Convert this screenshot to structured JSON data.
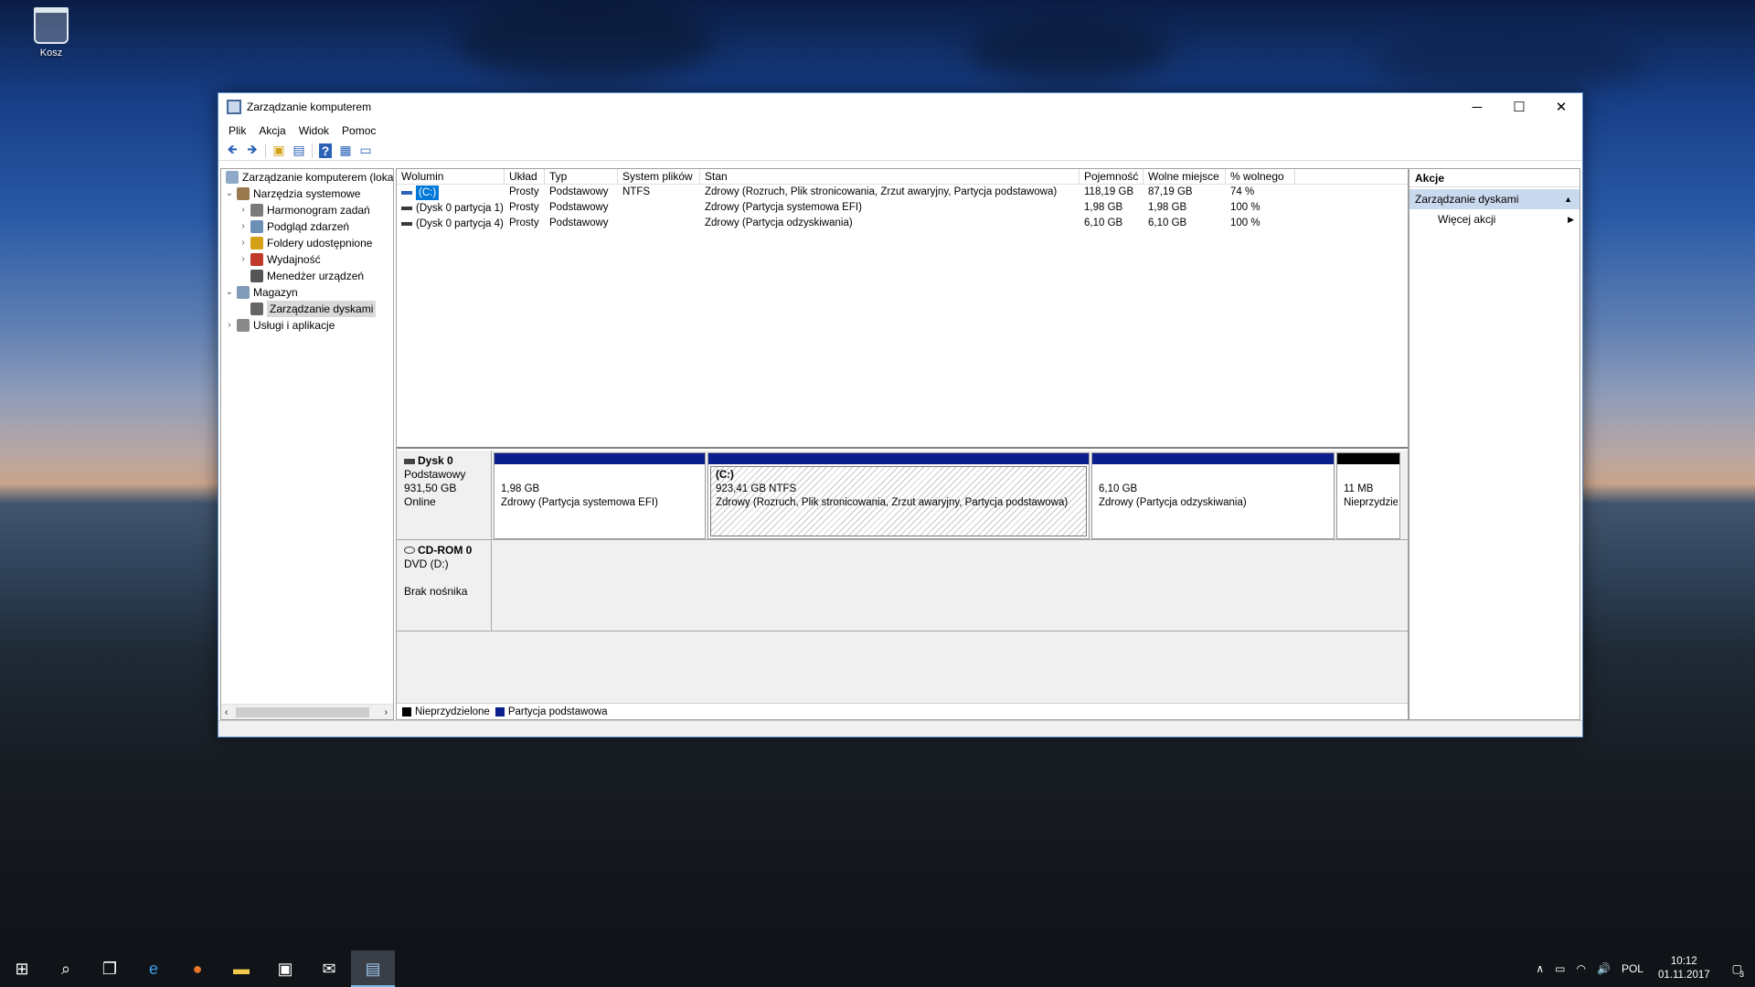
{
  "desktop": {
    "recycle_bin_label": "Kosz"
  },
  "window": {
    "title": "Zarządzanie komputerem",
    "min": "─",
    "max": "☐",
    "close": "✕"
  },
  "menu": [
    "Plik",
    "Akcja",
    "Widok",
    "Pomoc"
  ],
  "toolbar": [
    {
      "icon": "back-arrow-icon",
      "glyph": "🡸"
    },
    {
      "icon": "forward-arrow-icon",
      "glyph": "🡺"
    },
    {
      "icon": "up-folder-icon",
      "glyph": "▣"
    },
    {
      "icon": "show-hide-tree-icon",
      "glyph": "▤"
    },
    {
      "icon": "help-icon",
      "glyph": "?"
    },
    {
      "icon": "properties-icon",
      "glyph": "▦"
    },
    {
      "icon": "export-list-icon",
      "glyph": "▭"
    }
  ],
  "tree": {
    "root": "Zarządzanie komputerem (loka",
    "items": [
      {
        "label": "Narzędzia systemowe",
        "level": 1,
        "tw": "⌄",
        "icon": "tools-icon"
      },
      {
        "label": "Harmonogram zadań",
        "level": 2,
        "tw": "›",
        "icon": "clock-icon"
      },
      {
        "label": "Podgląd zdarzeń",
        "level": 2,
        "tw": "›",
        "icon": "event-viewer-icon"
      },
      {
        "label": "Foldery udostępnione",
        "level": 2,
        "tw": "›",
        "icon": "shared-folder-icon"
      },
      {
        "label": "Wydajność",
        "level": 2,
        "tw": "›",
        "icon": "performance-icon"
      },
      {
        "label": "Menedżer urządzeń",
        "level": 2,
        "tw": "",
        "icon": "device-manager-icon"
      },
      {
        "label": "Magazyn",
        "level": 1,
        "tw": "⌄",
        "icon": "storage-icon"
      },
      {
        "label": "Zarządzanie dyskami",
        "level": 2,
        "tw": "",
        "icon": "disk-icon",
        "selected": true
      },
      {
        "label": "Usługi i aplikacje",
        "level": 1,
        "tw": "›",
        "icon": "services-icon"
      }
    ]
  },
  "grid": {
    "headers": [
      "Wolumin",
      "Układ",
      "Typ",
      "System plików",
      "Stan",
      "Pojemność",
      "Wolne miejsce",
      "% wolnego"
    ],
    "rows": [
      [
        "(C:)",
        "Prosty",
        "Podstawowy",
        "NTFS",
        "Zdrowy (Rozruch, Plik stronicowania, Zrzut awaryjny, Partycja podstawowa)",
        "118,19 GB",
        "87,19 GB",
        "74 %"
      ],
      [
        "(Dysk 0 partycja 1)",
        "Prosty",
        "Podstawowy",
        "",
        "Zdrowy (Partycja systemowa EFI)",
        "1,98 GB",
        "1,98 GB",
        "100 %"
      ],
      [
        "(Dysk 0 partycja 4)",
        "Prosty",
        "Podstawowy",
        "",
        "Zdrowy (Partycja odzyskiwania)",
        "6,10 GB",
        "6,10 GB",
        "100 %"
      ]
    ]
  },
  "disks": [
    {
      "name": "Dysk 0",
      "lines": [
        "Podstawowy",
        "931,50 GB",
        "Online"
      ],
      "partitions": [
        {
          "title": "",
          "size": "1,98 GB",
          "status": "Zdrowy (Partycja systemowa EFI)"
        },
        {
          "title": "(C:)",
          "size": "923,41 GB NTFS",
          "status": "Zdrowy (Rozruch, Plik stronicowania, Zrzut awaryjny, Partycja podstawowa)"
        },
        {
          "title": "",
          "size": "6,10 GB",
          "status": "Zdrowy (Partycja odzyskiwania)"
        },
        {
          "title": "",
          "size": "11 MB",
          "status": "Nieprzydzie"
        }
      ]
    },
    {
      "name": "CD-ROM 0",
      "lines": [
        "DVD (D:)",
        "",
        "Brak nośnika"
      ]
    }
  ],
  "legend": {
    "unallocated": "Nieprzydzielone",
    "primary": "Partycja podstawowa"
  },
  "colors": {
    "primary": "#0a1e8c",
    "unallocated": "#000000",
    "accent": "#0078d7",
    "actions_section": "#c9d9ee"
  },
  "actions": {
    "header": "Akcje",
    "section": "Zarządzanie dyskami",
    "section_arrow": "▲",
    "more": "Więcej akcji",
    "more_arrow": "▶"
  },
  "taskbar": {
    "items": [
      {
        "icon": "start-icon",
        "glyph": "⊞"
      },
      {
        "icon": "search-icon",
        "glyph": "⌕"
      },
      {
        "icon": "task-view-icon",
        "glyph": "❐"
      },
      {
        "icon": "edge-icon",
        "glyph": "e"
      },
      {
        "icon": "firefox-icon",
        "glyph": "●"
      },
      {
        "icon": "file-explorer-icon",
        "glyph": "▬"
      },
      {
        "icon": "store-icon",
        "glyph": "▣"
      },
      {
        "icon": "mail-icon",
        "glyph": "✉"
      },
      {
        "icon": "computer-management-icon",
        "glyph": "▤",
        "active": true
      }
    ],
    "tray": {
      "chevron": "∧",
      "battery": "▭",
      "wifi": "◠",
      "volume": "🔊",
      "lang": "POL",
      "time": "10:12",
      "date": "01.11.2017",
      "notif": "3"
    }
  }
}
